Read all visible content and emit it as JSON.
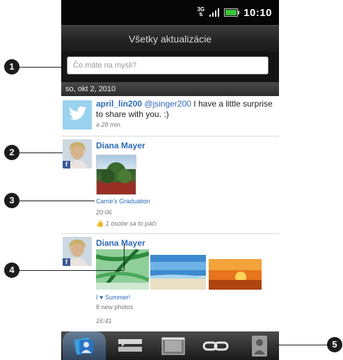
{
  "statusbar": {
    "time": "10:10",
    "network": "3G",
    "icons": [
      "3g-icon",
      "signal-icon",
      "battery-icon"
    ]
  },
  "header": {
    "title": "Všetky aktualizácie"
  },
  "composer": {
    "placeholder": "Čo máte na mysli?"
  },
  "feed": {
    "date_header": "so, okt 2, 2010",
    "items": [
      {
        "source": "twitter",
        "name": "april_lin200",
        "mention": "@jsinger200",
        "text": "I have a little surprise to share with you. :)",
        "time": "a 28 min."
      },
      {
        "source": "facebook",
        "name": "Diana Mayer",
        "photo_caption": "Carrie's Graduation",
        "time": "20:06",
        "likes": "1 osobe sa to páči"
      },
      {
        "source": "facebook",
        "name": "Diana Mayer",
        "caption": "I ♥ Summer!",
        "photo_count": "8 new photos",
        "time": "16:41"
      }
    ]
  },
  "bottom_tabs": [
    {
      "name": "all-updates",
      "icon": "people-icon",
      "active": true
    },
    {
      "name": "messages",
      "icon": "messages-icon"
    },
    {
      "name": "photos",
      "icon": "photos-icon"
    },
    {
      "name": "links",
      "icon": "link-icon"
    },
    {
      "name": "people",
      "icon": "person-icon"
    }
  ],
  "callouts": [
    "1",
    "2",
    "3",
    "4",
    "5"
  ],
  "colors": {
    "accent": "#2c6bb4",
    "facebook": "#3b5998",
    "twitter": "#4aa8d8"
  }
}
